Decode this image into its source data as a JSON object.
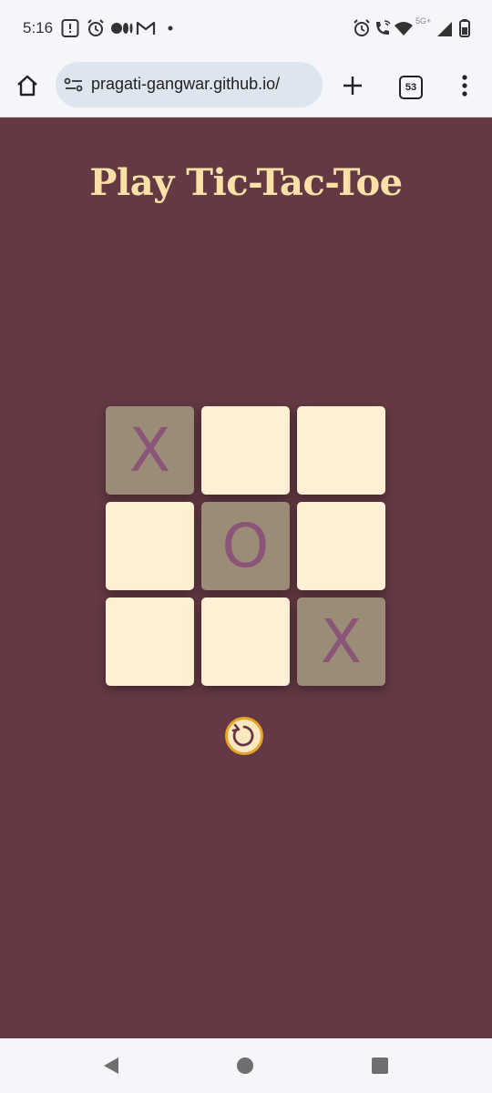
{
  "status_bar": {
    "time": "5:16",
    "network_label": "5G+",
    "icons": [
      "alert-icon",
      "alarm-icon",
      "media-icon",
      "gmail-icon",
      "dot-icon",
      "alarm-icon",
      "wifi-call-icon",
      "wifi-icon",
      "signal-icon",
      "battery-icon"
    ]
  },
  "browser": {
    "url": "pragati-gangwar.github.io/",
    "tab_count": "53",
    "icons": [
      "home-icon",
      "site-settings-icon",
      "new-tab-icon",
      "menu-icon"
    ]
  },
  "game": {
    "title": "Play Tic-Tac-Toe",
    "board": [
      [
        "X",
        "",
        ""
      ],
      [
        "",
        "O",
        ""
      ],
      [
        "",
        "",
        "X"
      ]
    ],
    "reset_icon": "restart-icon"
  },
  "colors": {
    "page_background": "#643944",
    "title": "#fbe0a8",
    "cell_empty": "#fdf0d5",
    "cell_filled": "#9b8c77",
    "mark": "#8a5576",
    "reset_border": "#e6a52a"
  },
  "nav_bar": {
    "icons": [
      "back-icon",
      "home-circle-icon",
      "recents-icon"
    ]
  }
}
